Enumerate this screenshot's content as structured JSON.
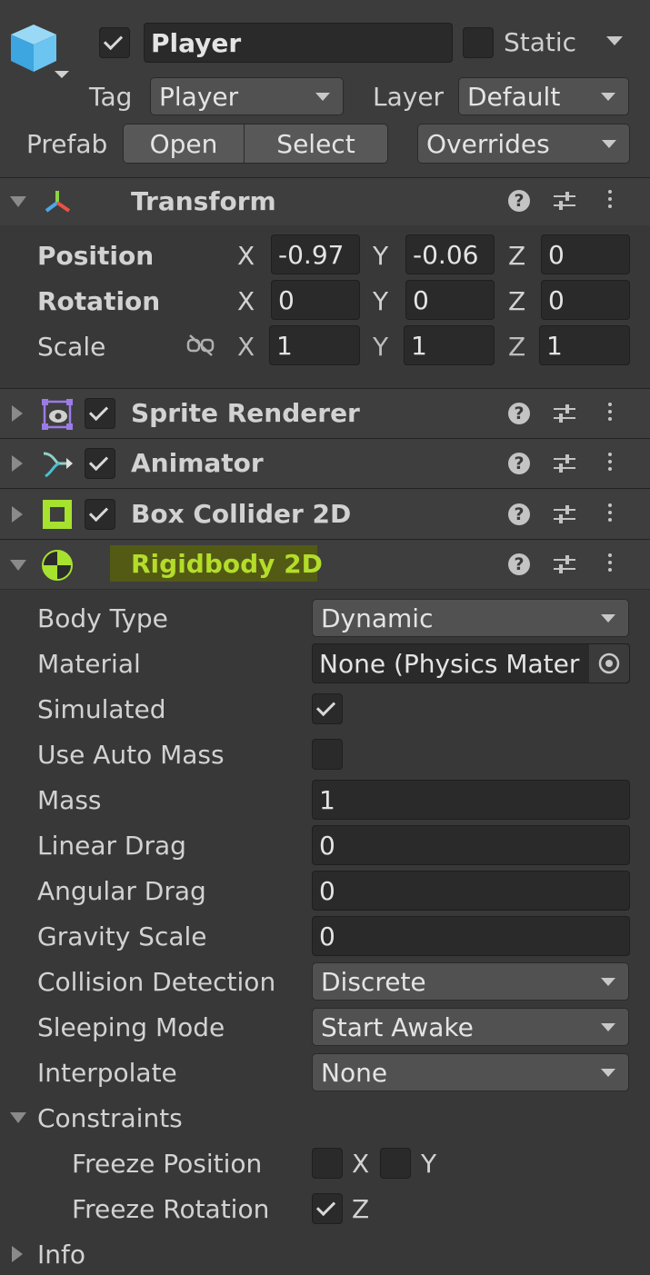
{
  "gameobject": {
    "name": "Player",
    "static_label": "Static",
    "tag_label": "Tag",
    "tag_value": "Player",
    "layer_label": "Layer",
    "layer_value": "Default",
    "prefab_label": "Prefab",
    "open_label": "Open",
    "select_label": "Select",
    "overrides_label": "Overrides",
    "active": true,
    "static": false
  },
  "transform": {
    "title": "Transform",
    "position_label": "Position",
    "rotation_label": "Rotation",
    "scale_label": "Scale",
    "x_label": "X",
    "y_label": "Y",
    "z_label": "Z",
    "position": {
      "x": "-0.97",
      "y": "-0.06",
      "z": "0"
    },
    "rotation": {
      "x": "0",
      "y": "0",
      "z": "0"
    },
    "scale": {
      "x": "1",
      "y": "1",
      "z": "1"
    }
  },
  "components": {
    "sprite_renderer": {
      "title": "Sprite Renderer",
      "enabled": true
    },
    "animator": {
      "title": "Animator",
      "enabled": true
    },
    "box_collider": {
      "title": "Box Collider 2D",
      "enabled": true
    },
    "rigidbody": {
      "title": "Rigidbody 2D"
    }
  },
  "rigidbody": {
    "body_type_label": "Body Type",
    "body_type_value": "Dynamic",
    "material_label": "Material",
    "material_value": "None (Physics Mater",
    "simulated_label": "Simulated",
    "simulated": true,
    "use_auto_mass_label": "Use Auto Mass",
    "use_auto_mass": false,
    "mass_label": "Mass",
    "mass_value": "1",
    "linear_drag_label": "Linear Drag",
    "linear_drag_value": "0",
    "angular_drag_label": "Angular Drag",
    "angular_drag_value": "0",
    "gravity_scale_label": "Gravity Scale",
    "gravity_scale_value": "0",
    "collision_detection_label": "Collision Detection",
    "collision_detection_value": "Discrete",
    "sleeping_mode_label": "Sleeping Mode",
    "sleeping_mode_value": "Start Awake",
    "interpolate_label": "Interpolate",
    "interpolate_value": "None",
    "constraints_label": "Constraints",
    "freeze_position_label": "Freeze Position",
    "freeze_rotation_label": "Freeze Rotation",
    "x_label": "X",
    "y_label": "Y",
    "z_label": "Z",
    "freeze_position_x": false,
    "freeze_position_y": false,
    "freeze_rotation_z": true,
    "info_label": "Info"
  },
  "colors": {
    "background": "#383838",
    "header": "#3e3e3e",
    "field": "#2a2a2a",
    "rigidbody_highlight_bg": "#535a13",
    "rigidbody_highlight_text": "#b3dd2a"
  }
}
